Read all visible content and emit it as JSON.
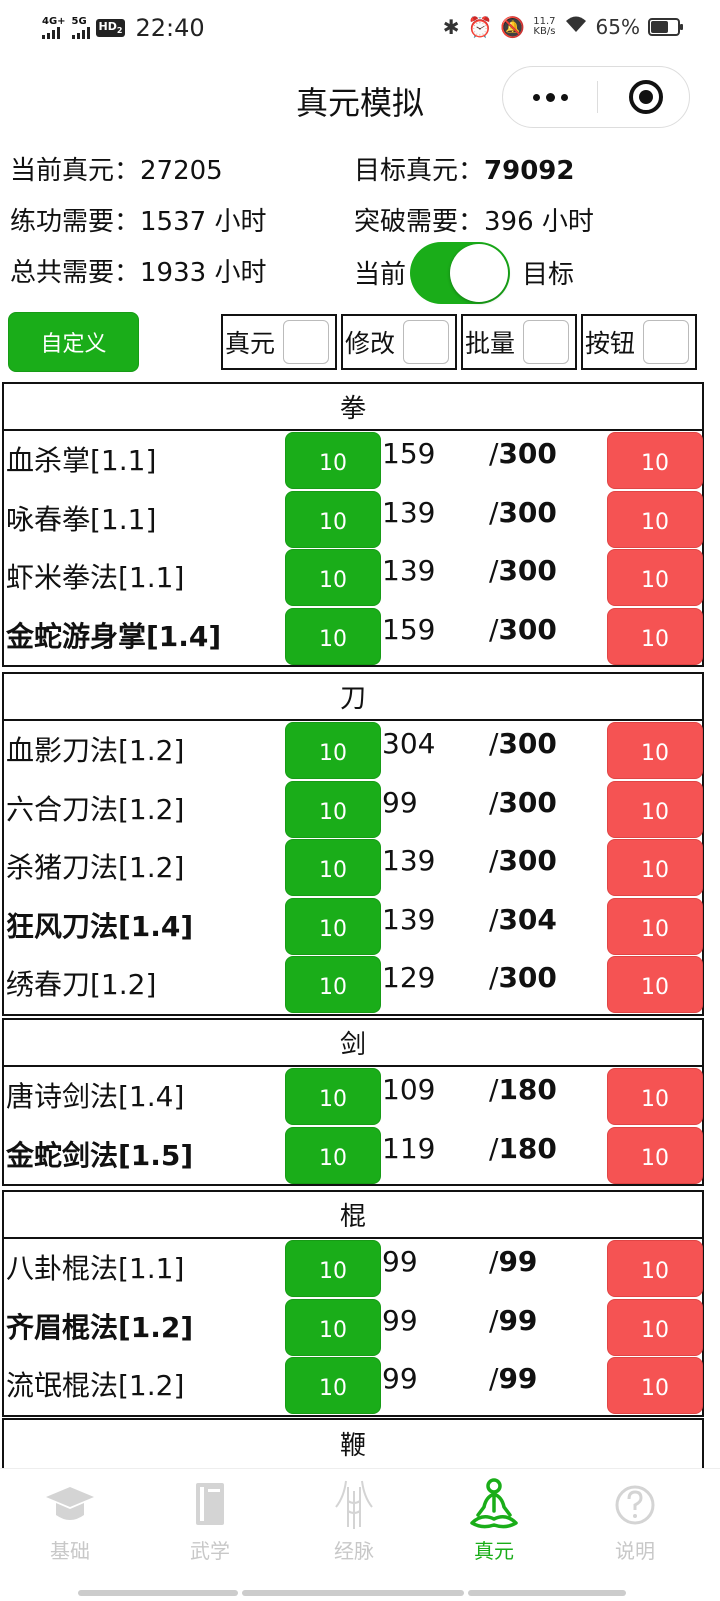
{
  "status_bar": {
    "net1": "4G+",
    "net2": "5G",
    "hd": "HD",
    "hd_sub": "2",
    "time": "22:40",
    "speed_value": "11.7",
    "speed_unit": "KB/s",
    "battery": "65%",
    "battery_level": 0.65
  },
  "nav": {
    "title": "真元模拟"
  },
  "summary": {
    "current_label": "当前真元：",
    "current_value": "27205",
    "target_label": "目标真元：",
    "target_value": "79092",
    "practice_label": "练功需要：",
    "practice_value": "1537 小时",
    "breakthrough_label": "突破需要：",
    "breakthrough_value": "396 小时",
    "total_label": "总共需要：",
    "total_value": "1933 小时",
    "toggle_left": "当前",
    "toggle_right": "目标",
    "toggle_on": true
  },
  "toolbar": {
    "custom_button": "自定义",
    "options": [
      {
        "label": "真元"
      },
      {
        "label": "修改"
      },
      {
        "label": "批量"
      },
      {
        "label": "按钮"
      }
    ]
  },
  "sections": [
    {
      "title": "拳",
      "rows": [
        {
          "name": "血杀掌[1.1]",
          "bold": false,
          "plus": "10",
          "current": "159",
          "max": "300",
          "minus": "10"
        },
        {
          "name": "咏春拳[1.1]",
          "bold": false,
          "plus": "10",
          "current": "139",
          "max": "300",
          "minus": "10"
        },
        {
          "name": "虾米拳法[1.1]",
          "bold": false,
          "plus": "10",
          "current": "139",
          "max": "300",
          "minus": "10"
        },
        {
          "name": "金蛇游身掌[1.4]",
          "bold": true,
          "plus": "10",
          "current": "159",
          "max": "300",
          "minus": "10"
        }
      ]
    },
    {
      "title": "刀",
      "rows": [
        {
          "name": "血影刀法[1.2]",
          "bold": false,
          "plus": "10",
          "current": "304",
          "max": "300",
          "minus": "10"
        },
        {
          "name": "六合刀法[1.2]",
          "bold": false,
          "plus": "10",
          "current": "99",
          "max": "300",
          "minus": "10"
        },
        {
          "name": "杀猪刀法[1.2]",
          "bold": false,
          "plus": "10",
          "current": "139",
          "max": "300",
          "minus": "10"
        },
        {
          "name": "狂风刀法[1.4]",
          "bold": true,
          "plus": "10",
          "current": "139",
          "max": "304",
          "minus": "10"
        },
        {
          "name": "绣春刀[1.2]",
          "bold": false,
          "plus": "10",
          "current": "129",
          "max": "300",
          "minus": "10"
        }
      ]
    },
    {
      "title": "剑",
      "rows": [
        {
          "name": "唐诗剑法[1.4]",
          "bold": false,
          "plus": "10",
          "current": "109",
          "max": "180",
          "minus": "10"
        },
        {
          "name": "金蛇剑法[1.5]",
          "bold": true,
          "plus": "10",
          "current": "119",
          "max": "180",
          "minus": "10"
        }
      ]
    },
    {
      "title": "棍",
      "rows": [
        {
          "name": "八卦棍法[1.1]",
          "bold": false,
          "plus": "10",
          "current": "99",
          "max": "99",
          "minus": "10"
        },
        {
          "name": "齐眉棍法[1.2]",
          "bold": true,
          "plus": "10",
          "current": "99",
          "max": "99",
          "minus": "10"
        },
        {
          "name": "流氓棍法[1.2]",
          "bold": false,
          "plus": "10",
          "current": "99",
          "max": "99",
          "minus": "10"
        }
      ]
    },
    {
      "title": "鞭",
      "rows": []
    }
  ],
  "tabbar": {
    "tabs": [
      {
        "label": "基础",
        "icon": "graduation-cap-icon",
        "active": false
      },
      {
        "label": "武学",
        "icon": "book-icon",
        "active": false
      },
      {
        "label": "经脉",
        "icon": "body-meridian-icon",
        "active": false
      },
      {
        "label": "真元",
        "icon": "meditation-icon",
        "active": true
      },
      {
        "label": "说明",
        "icon": "question-icon",
        "active": false
      }
    ],
    "active_color": "#1aad19",
    "inactive_color": "#c8c8c8"
  },
  "colors": {
    "green": "#1aad19",
    "red": "#f55353"
  }
}
